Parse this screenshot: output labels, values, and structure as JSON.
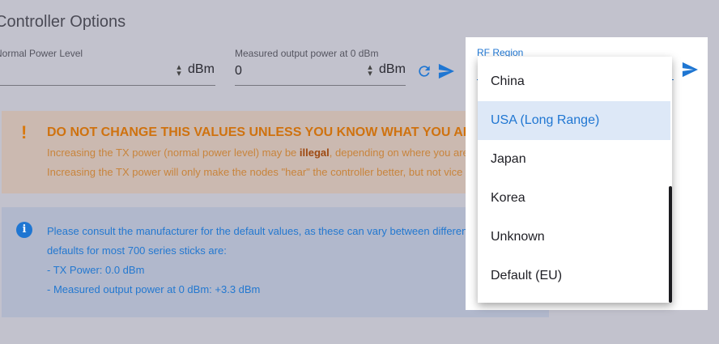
{
  "page": {
    "title": "Controller Options"
  },
  "normal_power": {
    "label": "Normal Power Level",
    "value": "",
    "unit": "dBm"
  },
  "measured_power": {
    "label": "Measured output power at 0 dBm",
    "value": "0",
    "unit": "dBm"
  },
  "icons": {
    "refresh": "refresh-icon",
    "send": "send-icon",
    "warning": "exclamation-icon",
    "info": "info-icon"
  },
  "warning": {
    "mark": "!",
    "heading": "DO NOT CHANGE THIS VALUES UNLESS YOU KNOW WHAT YOU ARE",
    "line1_pre": "Increasing the TX power (normal power level) may be ",
    "line1_bold": "illegal",
    "line1_post": ", depending on where you are lo",
    "line2": "Increasing the TX power will only make the nodes \"hear\" the controller better, but not vice ver"
  },
  "info": {
    "icon_glyph": "i",
    "lines": [
      "Please consult the manufacturer for the default values, as these can vary between different s",
      "defaults for most 700 series sticks are:",
      "- TX Power: 0.0 dBm",
      "- Measured output power at 0 dBm: +3.3 dBm"
    ]
  },
  "rf_region": {
    "label": "RF Region",
    "options": [
      "China",
      "USA (Long Range)",
      "Japan",
      "Korea",
      "Unknown",
      "Default (EU)"
    ],
    "selected": "USA (Long Range)"
  },
  "colors": {
    "accent": "#1f76d2",
    "warning": "#cf720f",
    "background": "#c2c2cd"
  }
}
